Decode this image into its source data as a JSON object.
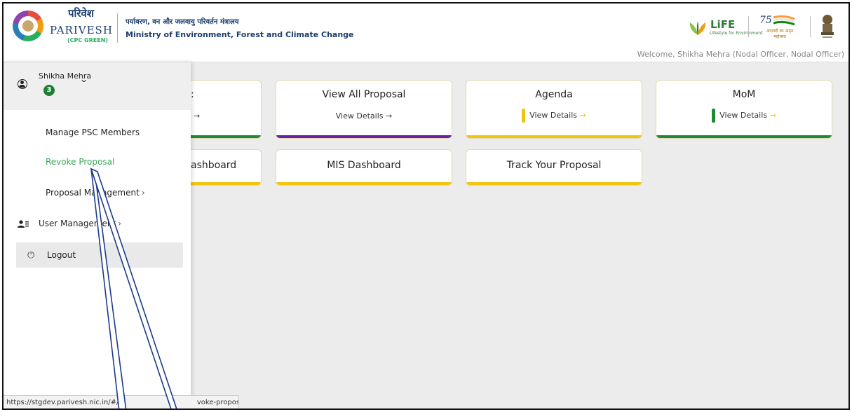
{
  "header": {
    "brand_hindi": "परिवेश",
    "brand_english": "PARIVESH",
    "brand_sub": "(CPC GREEN)",
    "ministry_hindi": "पर्यावरण, वन और जलवायु परिवर्तन मंत्रालय",
    "ministry_english": "Ministry of Environment, Forest and Climate Change",
    "life_title": "LiFE",
    "life_sub": "Lifestyle for Environment",
    "azadi_text": "आज़ादी का अमृत महोत्सव",
    "welcome": "Welcome, Shikha Mehra (Nodal Officer, Nodal Officer)"
  },
  "sidebar": {
    "user_name": "Shikha Mehra",
    "badge_count": "3",
    "items": [
      {
        "label": "Manage PSC Members"
      },
      {
        "label": "Revoke Proposal"
      },
      {
        "label": "Proposal Management"
      },
      {
        "label": "User Management"
      }
    ],
    "logout_label": "Logout"
  },
  "cards": [
    {
      "title": ":",
      "link": "→"
    },
    {
      "title": "View All Proposal",
      "link": "View Details →"
    },
    {
      "title": "Agenda",
      "link": "View Details"
    },
    {
      "title": "MoM",
      "link": "View Details"
    },
    {
      "title": "ashboard"
    },
    {
      "title": "MIS Dashboard"
    },
    {
      "title": "Track Your Proposal"
    }
  ],
  "card_arrow": "→",
  "colors": {
    "green": "#1e8a35",
    "purple": "#6a1fa8",
    "yellow": "#f1c40f",
    "active_nav": "#3aa655"
  },
  "statusbar": {
    "url_left": "https://stgdev.parivesh.nic.in/#/c",
    "url_right": "voke-proposal-list"
  }
}
